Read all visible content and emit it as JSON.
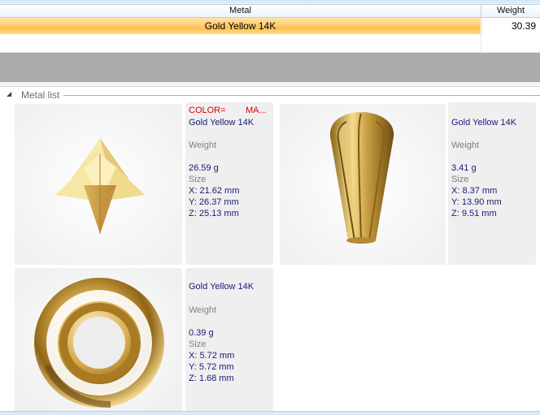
{
  "table": {
    "headers": {
      "metal": "Metal",
      "weight": "Weight"
    },
    "rows": [
      {
        "metal": "Gold Yellow 14K",
        "weight": "30.39"
      }
    ]
  },
  "group": {
    "title": "Metal list"
  },
  "cards": [
    {
      "header_color": "COLOR=",
      "header_ma": "MA...",
      "metal": "Gold Yellow 14K",
      "weight_label": "Weight",
      "weight": "26.59 g",
      "size_label": "Size",
      "x": "X: 21.62 mm",
      "y": "Y: 26.37 mm",
      "z": "Z: 25.13 mm",
      "shape": "star-tetrahedron"
    },
    {
      "metal": "Gold Yellow 14K",
      "weight_label": "Weight",
      "weight": "3.41 g",
      "size_label": "Size",
      "x": "X: 8.37 mm",
      "y": "Y: 13.90 mm",
      "z": "Z: 9.51 mm",
      "shape": "fluted-pendant-bail"
    },
    {
      "metal": "Gold Yellow 14K",
      "weight_label": "Weight",
      "weight": "0.39 g",
      "size_label": "Size",
      "x": "X: 5.72 mm",
      "y": "Y: 5.72 mm",
      "z": "Z: 1.68 mm",
      "shape": "gold-ring-washer"
    }
  ],
  "colors": {
    "selection": "#ffc860",
    "metal_text": "#1a1a7a",
    "label_text": "#808080",
    "color_header": "#e00000",
    "panel_bg": "#efefef",
    "band_grey": "#ababab"
  }
}
